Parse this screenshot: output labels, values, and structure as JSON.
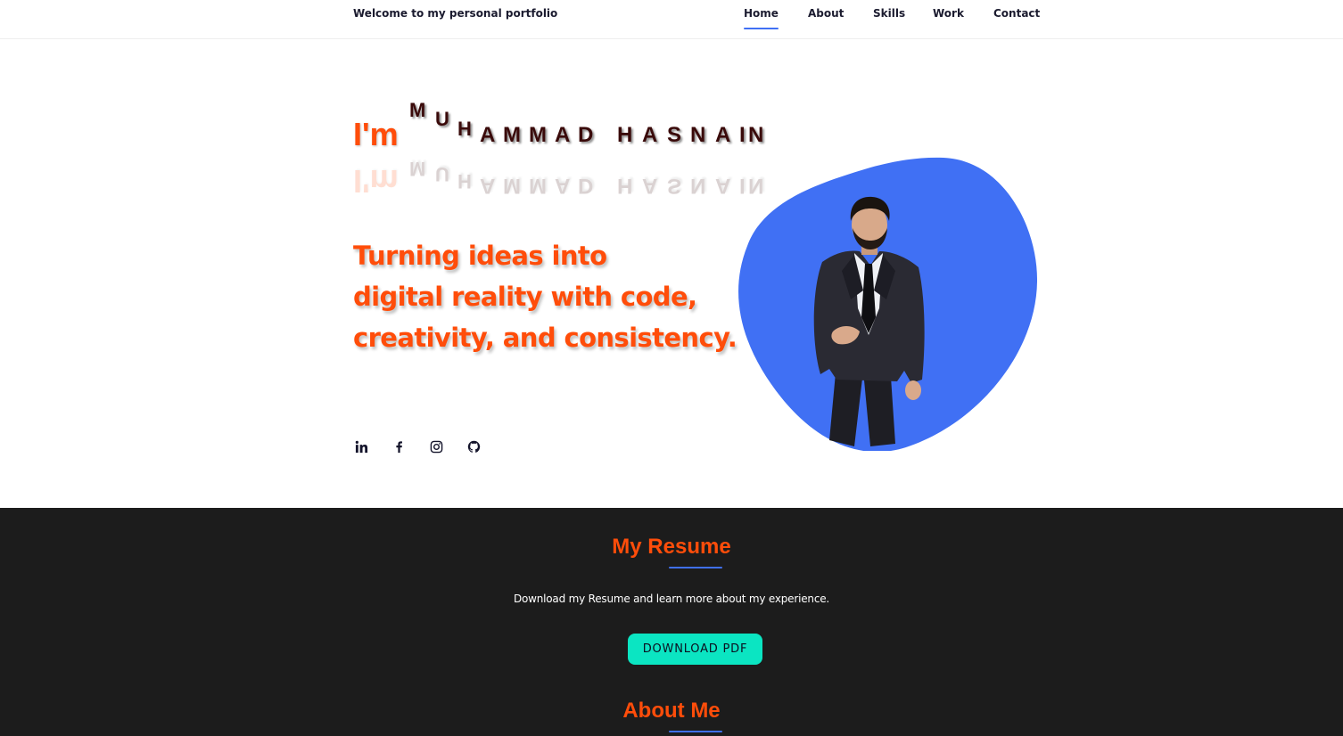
{
  "header": {
    "welcome": "Welcome to my personal portfolio",
    "nav": [
      {
        "label": "Home",
        "active": true
      },
      {
        "label": "About",
        "active": false
      },
      {
        "label": "Skills",
        "active": false
      },
      {
        "label": "Work",
        "active": false
      },
      {
        "label": "Contact",
        "active": false
      }
    ]
  },
  "hero": {
    "intro": "I'm",
    "name_letters": [
      "M",
      "U",
      "H",
      "A",
      "M",
      "M",
      "A",
      "D",
      "H",
      "A",
      "S",
      "N",
      "A",
      "I",
      "N"
    ],
    "tagline_lines": [
      "Turning ideas into",
      "digital reality with code,",
      "creativity, and consistency."
    ],
    "socials": [
      {
        "icon": "linkedin-icon"
      },
      {
        "icon": "facebook-icon"
      },
      {
        "icon": "instagram-icon"
      },
      {
        "icon": "github-icon"
      }
    ],
    "blob_color": "#4070f4"
  },
  "resume": {
    "title": "My Resume",
    "description": "Download my Resume and learn more about my experience.",
    "button_label": "DOWNLOAD PDF"
  },
  "about": {
    "title": "About Me"
  },
  "colors": {
    "accent": "#ff4d0a",
    "primary": "#4070f4",
    "button": "#0be5c2",
    "dark_bg": "#1c1c1c"
  }
}
